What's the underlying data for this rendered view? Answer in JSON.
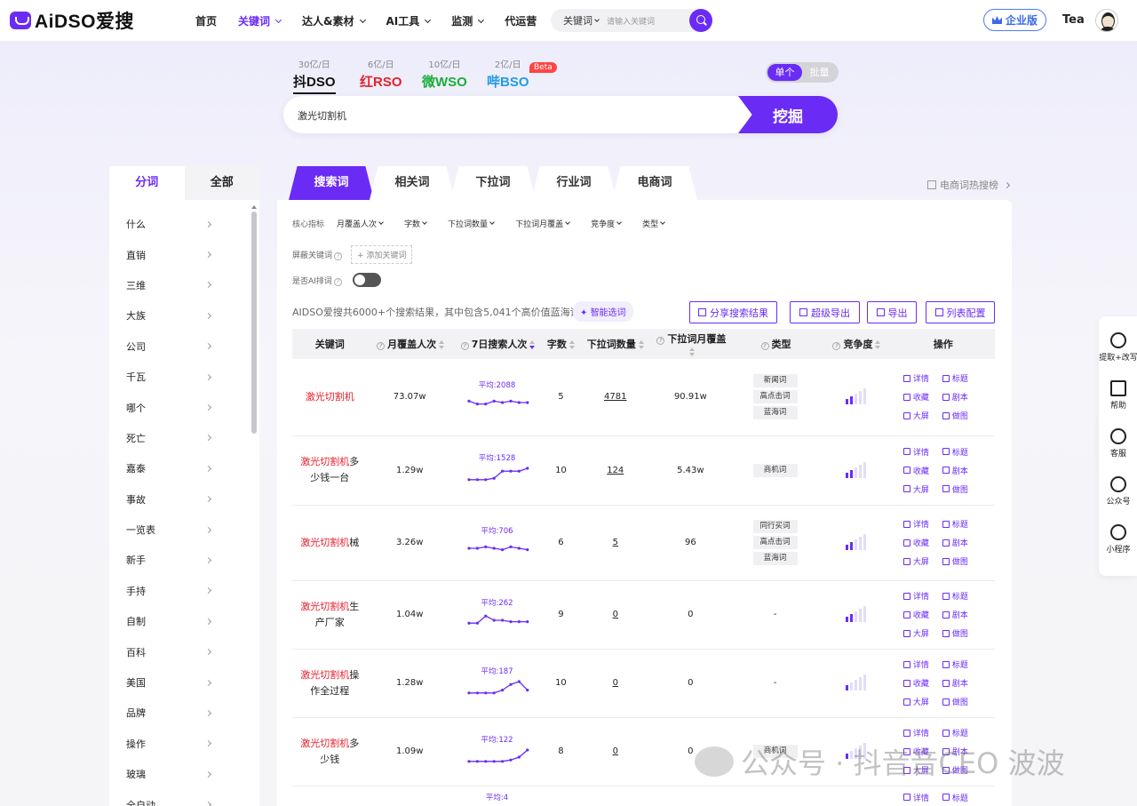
{
  "header": {
    "logo": "AiDSO爱搜",
    "nav": [
      {
        "label": "首页",
        "active": false,
        "dropdown": false
      },
      {
        "label": "关键词",
        "active": true,
        "dropdown": true
      },
      {
        "label": "达人&素材",
        "active": false,
        "dropdown": true
      },
      {
        "label": "AI工具",
        "active": false,
        "dropdown": true
      },
      {
        "label": "监测",
        "active": false,
        "dropdown": true
      },
      {
        "label": "代运营",
        "active": false,
        "dropdown": false
      }
    ],
    "search_select": "关键词",
    "search_placeholder": "请输入关键词",
    "enterprise_label": "企业版",
    "user_name": "Tea"
  },
  "platforms": [
    {
      "count": "30亿/日",
      "name": "抖DSO",
      "color": "#111111",
      "active": true
    },
    {
      "count": "6亿/日",
      "name": "红RSO",
      "color": "#e8202e",
      "active": false
    },
    {
      "count": "10亿/日",
      "name": "微WSO",
      "color": "#1aad3a",
      "active": false
    },
    {
      "count": "2亿/日",
      "name": "哔BSO",
      "color": "#1e9be8",
      "active": false
    }
  ],
  "beta_label": "Beta",
  "mode": {
    "single": "单个",
    "batch": "批量"
  },
  "main_search": {
    "value": "激光切割机",
    "button": "挖掘"
  },
  "left_panel": {
    "tabs": [
      "分词",
      "全部"
    ],
    "items": [
      "什么",
      "直销",
      "三维",
      "大族",
      "公司",
      "千瓦",
      "哪个",
      "死亡",
      "嘉泰",
      "事故",
      "一览表",
      "新手",
      "手持",
      "自制",
      "百科",
      "美国",
      "品牌",
      "操作",
      "玻璃",
      "全自动"
    ]
  },
  "keyword_tabs": [
    "搜索词",
    "相关词",
    "下拉词",
    "行业词",
    "电商词"
  ],
  "hot_rank": "电商词热搜榜",
  "filters": {
    "core_label": "核心指标",
    "core_options": [
      "月覆盖人次",
      "字数",
      "下拉词数量",
      "下拉词月覆盖",
      "竞争度",
      "类型"
    ],
    "block_label": "屏蔽关键词",
    "add_keyword": "添加关键词",
    "ai_label": "是否AI排词"
  },
  "summary": "AIDSO爱搜共6000+个搜索结果，其中包含5,041个高价值蓝海词",
  "smart_select": "智能选词",
  "actions": [
    "分享搜索结果",
    "超级导出",
    "导出",
    "列表配置"
  ],
  "table": {
    "headers": [
      "关键词",
      "月覆盖人次",
      "7日搜索人次",
      "字数",
      "下拉词数量",
      "下拉词月覆盖",
      "类型",
      "竞争度",
      "操作"
    ],
    "rows": [
      {
        "kw_hl": "激光切割机",
        "kw_rest": "",
        "monthly": "73.07w",
        "avg": "平均:2088",
        "trend": [
          6,
          4,
          4,
          6,
          5,
          6,
          5,
          5
        ],
        "chars": "5",
        "dropdown": "4781",
        "dropdown_monthly": "90.91w",
        "types": [
          "新闻词",
          "高点击词",
          "蓝海词"
        ],
        "competition": 2
      },
      {
        "kw_hl": "激光切割机",
        "kw_rest": "多少钱一台",
        "monthly": "1.29w",
        "avg": "平均:1528",
        "trend": [
          2,
          2,
          2,
          3,
          8,
          8,
          8,
          10
        ],
        "chars": "10",
        "dropdown": "124",
        "dropdown_monthly": "5.43w",
        "types": [
          "商机词"
        ],
        "competition": 2
      },
      {
        "kw_hl": "激光切割机",
        "kw_rest": "械",
        "monthly": "3.26w",
        "avg": "平均:706",
        "trend": [
          5,
          5,
          6,
          5,
          4,
          6,
          5,
          4
        ],
        "chars": "6",
        "dropdown": "5",
        "dropdown_monthly": "96",
        "types": [
          "同行买词",
          "高点击词",
          "蓝海词"
        ],
        "competition": 2
      },
      {
        "kw_hl": "激光切割机",
        "kw_rest": "生产厂家",
        "monthly": "1.04w",
        "avg": "平均:262",
        "trend": [
          3,
          3,
          8,
          5,
          5,
          4,
          4,
          4
        ],
        "chars": "9",
        "dropdown": "0",
        "dropdown_monthly": "0",
        "types": [
          "-"
        ],
        "competition": 2
      },
      {
        "kw_hl": "激光切割机",
        "kw_rest": "操作全过程",
        "monthly": "1.28w",
        "avg": "平均:187",
        "trend": [
          2,
          2,
          2,
          2,
          4,
          8,
          10,
          4
        ],
        "chars": "10",
        "dropdown": "0",
        "dropdown_monthly": "0",
        "types": [
          "-"
        ],
        "competition": 1
      },
      {
        "kw_hl": "激光切割机",
        "kw_rest": "多少钱",
        "monthly": "1.09w",
        "avg": "平均:122",
        "trend": [
          2,
          2,
          2,
          2,
          2,
          3,
          5,
          10
        ],
        "chars": "8",
        "dropdown": "0",
        "dropdown_monthly": "0",
        "types": [
          "商机词"
        ],
        "competition": 1
      }
    ],
    "next_avg": "平均:4",
    "ops": [
      "详情",
      "标题",
      "收藏",
      "剧本",
      "大屏",
      "做图"
    ]
  },
  "side_float": [
    "提取+改写",
    "帮助",
    "客服",
    "公众号",
    "小程序"
  ],
  "watermark": "公众号 · 抖音音CEO 波波",
  "colors": {
    "accent": "#6a2cf5",
    "highlight": "#e8202e"
  }
}
